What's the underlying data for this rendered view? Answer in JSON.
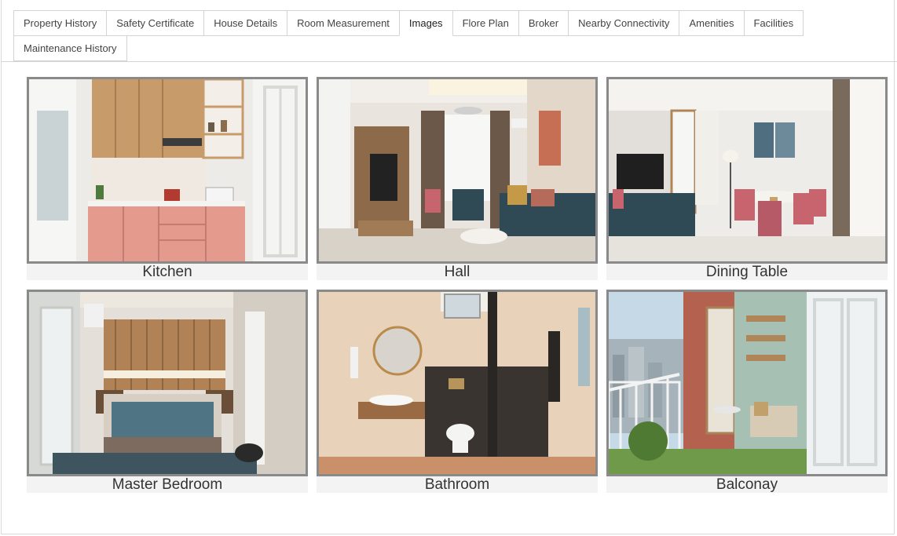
{
  "tabs": [
    {
      "label": "Property History",
      "active": false
    },
    {
      "label": "Safety Certificate",
      "active": false
    },
    {
      "label": "House Details",
      "active": false
    },
    {
      "label": "Room Measurement",
      "active": false
    },
    {
      "label": "Images",
      "active": true
    },
    {
      "label": "Flore Plan",
      "active": false
    },
    {
      "label": "Broker",
      "active": false
    },
    {
      "label": "Nearby Connectivity",
      "active": false
    },
    {
      "label": "Amenities",
      "active": false
    },
    {
      "label": "Facilities",
      "active": false
    },
    {
      "label": "Maintenance History",
      "active": false
    }
  ],
  "gallery": {
    "items": [
      {
        "caption": "Kitchen",
        "image": "kitchen-photo"
      },
      {
        "caption": "Hall",
        "image": "hall-photo"
      },
      {
        "caption": "Dining Table",
        "image": "dining-table-photo"
      },
      {
        "caption": "Master Bedroom",
        "image": "master-bedroom-photo"
      },
      {
        "caption": "Bathroom",
        "image": "bathroom-photo"
      },
      {
        "caption": "Balconay",
        "image": "balcony-photo"
      }
    ]
  },
  "colors": {
    "frame_border": "#8a8a8a",
    "caption_bg": "#f3f3f3",
    "tab_border": "#d4d4d4"
  }
}
